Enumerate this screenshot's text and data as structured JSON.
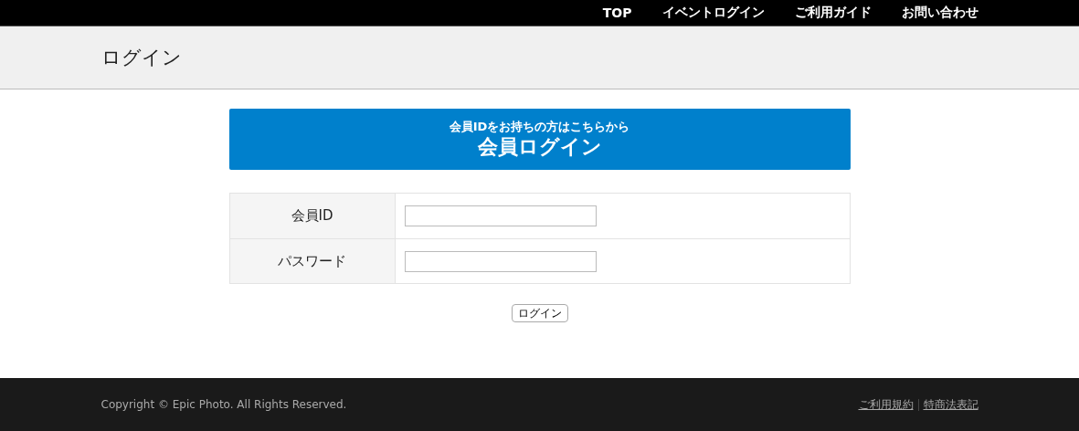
{
  "nav": [
    {
      "label": "TOP"
    },
    {
      "label": "イベントログイン"
    },
    {
      "label": "ご利用ガイド"
    },
    {
      "label": "お問い合わせ"
    }
  ],
  "page_title": "ログイン",
  "banner": {
    "subtitle": "会員IDをお持ちの方はこちらから",
    "title": "会員ログイン"
  },
  "form": {
    "fields": [
      {
        "label": "会員ID"
      },
      {
        "label": "パスワード"
      }
    ],
    "submit": "ログイン"
  },
  "footer": {
    "copyright": "Copyright © Epic Photo. All Rights Reserved.",
    "links": [
      {
        "label": "ご利用規約"
      },
      {
        "label": "特商法表記"
      }
    ]
  }
}
